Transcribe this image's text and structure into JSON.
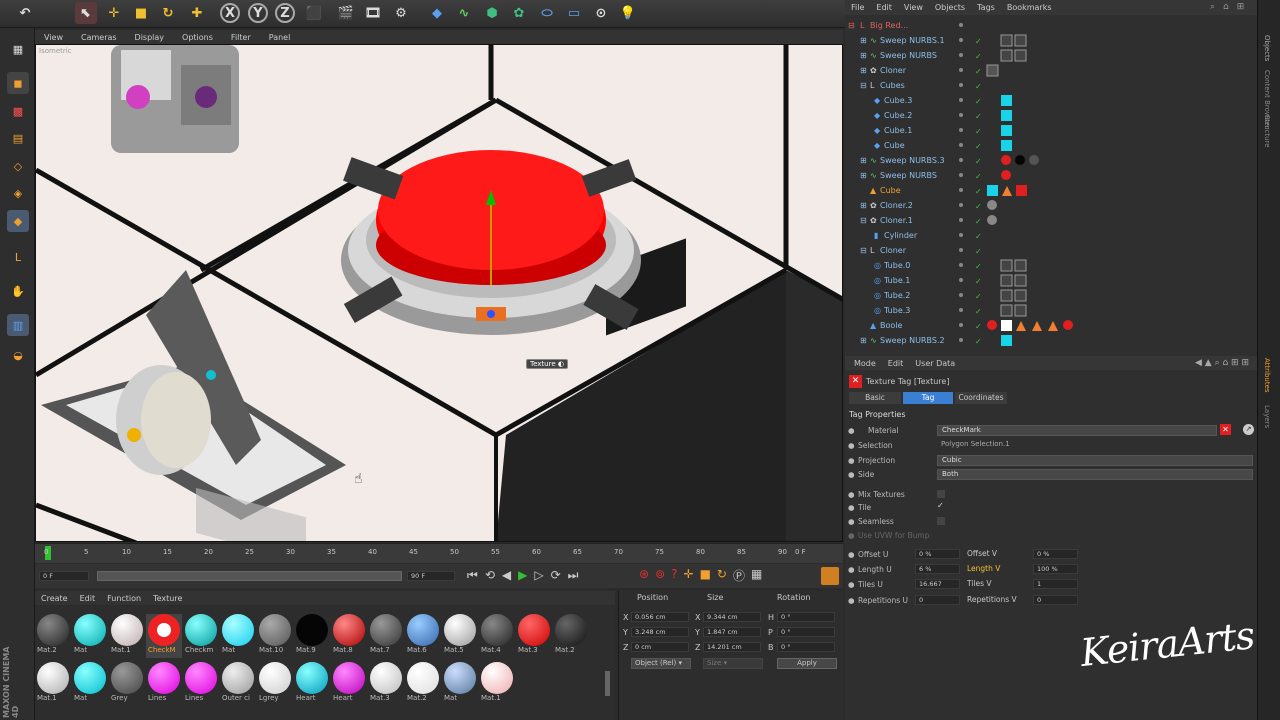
{
  "viewport_menu": [
    "View",
    "Cameras",
    "Display",
    "Options",
    "Filter",
    "Panel"
  ],
  "viewport_label": "Isometric",
  "texture_label": "Texture",
  "timeline": {
    "ticks": [
      "0",
      "5",
      "10",
      "15",
      "20",
      "25",
      "30",
      "35",
      "40",
      "45",
      "50",
      "55",
      "60",
      "65",
      "70",
      "75",
      "80",
      "85",
      "90"
    ],
    "frame_end_readout": "0 F",
    "start_field": "0 F",
    "end_field": "90 F"
  },
  "material_menu": [
    "Create",
    "Edit",
    "Function",
    "Texture"
  ],
  "materials_row1": [
    "Mat.2",
    "Mat",
    "Mat.1",
    "CheckM",
    "Checkm",
    "Mat",
    "Mat.10",
    "Mat.9",
    "Mat.8",
    "Mat.7",
    "Mat.6",
    "Mat.5",
    "Mat.4",
    "Mat.3",
    "Mat.2"
  ],
  "materials_row2": [
    "Mat.1",
    "Mat",
    "Grey",
    "Lines",
    "Lines",
    "Outer ci",
    "Lgrey",
    "Heart",
    "Heart",
    "Mat.3",
    "Mat.2",
    "Mat",
    "Mat.1"
  ],
  "coords": {
    "headers": [
      "Position",
      "Size",
      "Rotation"
    ],
    "rows": [
      {
        "axis": "X",
        "pos": "0.056 cm",
        "size_axis": "X",
        "size": "9.344 cm",
        "rot_axis": "H",
        "rot": "0 °"
      },
      {
        "axis": "Y",
        "pos": "3.248 cm",
        "size_axis": "Y",
        "size": "1.847 cm",
        "rot_axis": "P",
        "rot": "0 °"
      },
      {
        "axis": "Z",
        "pos": "0 cm",
        "size_axis": "Z",
        "size": "14.201 cm",
        "rot_axis": "B",
        "rot": "0 °"
      }
    ],
    "mode": "Object (Rel)",
    "size_mode": "Size",
    "apply": "Apply"
  },
  "objects_menu": [
    "File",
    "Edit",
    "View",
    "Objects",
    "Tags",
    "Bookmarks"
  ],
  "objects": [
    "Big Red...",
    "Sweep NURBS.1",
    "Sweep NURBS",
    "Cloner",
    "Cubes",
    "Cube.3",
    "Cube.2",
    "Cube.1",
    "Cube",
    "Sweep NURBS.3",
    "Sweep NURBS",
    "Cube",
    "Cloner.2",
    "Cloner.1",
    "Cylinder",
    "Cloner",
    "Tube.0",
    "Tube.1",
    "Tube.2",
    "Tube.3",
    "Boole",
    "Sweep NURBS.2"
  ],
  "attr": {
    "menu": [
      "Mode",
      "Edit",
      "User Data"
    ],
    "title": "Texture Tag [Texture]",
    "tabs": [
      "Basic",
      "Tag",
      "Coordinates"
    ],
    "section": "Tag Properties",
    "material_label": "Material",
    "material_value": "CheckMark",
    "selection_label": "Selection",
    "selection_value": "Polygon Selection.1",
    "projection_label": "Projection",
    "projection_value": "Cubic",
    "side_label": "Side",
    "side_value": "Both",
    "mix_label": "Mix Textures",
    "tile_label": "Tile",
    "seamless_label": "Seamless",
    "uvw_label": "Use UVW for Bump",
    "offset_u_label": "Offset U",
    "offset_u": "0 %",
    "offset_v_label": "Offset V",
    "offset_v": "0 %",
    "length_u_label": "Length U",
    "length_u": "6 %",
    "length_v_label": "Length V",
    "length_v": "100 %",
    "tiles_u_label": "Tiles U",
    "tiles_u": "16.667",
    "tiles_v_label": "Tiles V",
    "tiles_v": "1",
    "rep_u_label": "Repetitions U",
    "rep_u": "0",
    "rep_v_label": "Repetitions V",
    "rep_v": "0"
  },
  "brand": "MAXON CINEMA 4D",
  "watermark": "KeiraArts",
  "right_tabs": [
    "Objects",
    "Content Browser",
    "Structure",
    "Attributes",
    "Layers"
  ],
  "colors": {
    "accent": "#3b7fd4",
    "red": "#ff0000",
    "cyan": "#19d3e8"
  }
}
